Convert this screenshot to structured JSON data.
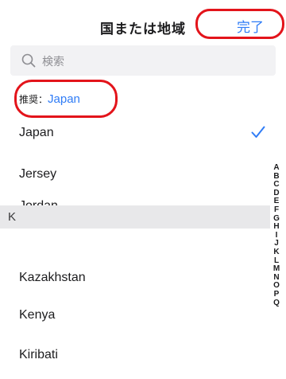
{
  "header": {
    "title": "国または地域",
    "done_label": "完了"
  },
  "search": {
    "placeholder": "検索",
    "value": ""
  },
  "recommend": {
    "label": "推奨：",
    "value": "Japan"
  },
  "list": {
    "rows_top": [
      "Japan",
      "Jersey",
      "Jordan"
    ],
    "selected_row": "Japan",
    "section_label": "K",
    "rows_bottom": [
      "Kazakhstan",
      "Kenya",
      "Kiribati"
    ]
  },
  "index": [
    "A",
    "B",
    "C",
    "D",
    "E",
    "F",
    "G",
    "H",
    "I",
    "J",
    "K",
    "L",
    "M",
    "N",
    "O",
    "P",
    "Q"
  ],
  "colors": {
    "accent": "#2f7cf6",
    "highlight_ring": "#e3141b",
    "section_bg": "#e8e8ea"
  },
  "icons": {
    "search": "search-icon",
    "check": "checkmark-icon"
  }
}
